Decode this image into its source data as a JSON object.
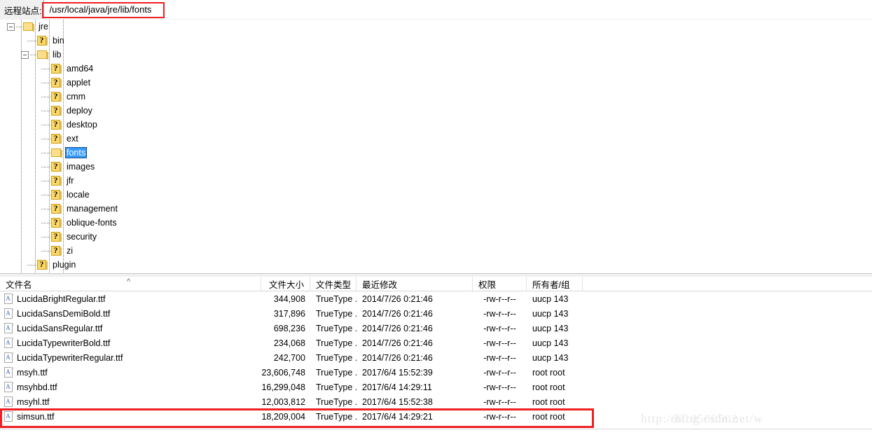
{
  "pathbar": {
    "label": "远程站点:",
    "value": "/usr/local/java/jre/lib/fonts",
    "placeholder": "/usr/local/java/jre/lib/fonts"
  },
  "highlight_color": "#ed2024",
  "selection_color": "#3399ff",
  "tree": {
    "nodes": [
      {
        "label": "jre",
        "depth": 4,
        "icon": "folder-icon",
        "expander": "expanded",
        "selected": false
      },
      {
        "label": "bin",
        "depth": 5,
        "icon": "unknown-folder-icon",
        "expander": "none",
        "selected": false
      },
      {
        "label": "lib",
        "depth": 5,
        "icon": "folder-icon",
        "expander": "expanded",
        "selected": false
      },
      {
        "label": "amd64",
        "depth": 6,
        "icon": "unknown-folder-icon",
        "expander": "none",
        "selected": false
      },
      {
        "label": "applet",
        "depth": 6,
        "icon": "unknown-folder-icon",
        "expander": "none",
        "selected": false
      },
      {
        "label": "cmm",
        "depth": 6,
        "icon": "unknown-folder-icon",
        "expander": "none",
        "selected": false
      },
      {
        "label": "deploy",
        "depth": 6,
        "icon": "unknown-folder-icon",
        "expander": "none",
        "selected": false
      },
      {
        "label": "desktop",
        "depth": 6,
        "icon": "unknown-folder-icon",
        "expander": "none",
        "selected": false
      },
      {
        "label": "ext",
        "depth": 6,
        "icon": "unknown-folder-icon",
        "expander": "none",
        "selected": false
      },
      {
        "label": "fonts",
        "depth": 6,
        "icon": "folder-icon",
        "expander": "none",
        "selected": true
      },
      {
        "label": "images",
        "depth": 6,
        "icon": "unknown-folder-icon",
        "expander": "none",
        "selected": false
      },
      {
        "label": "jfr",
        "depth": 6,
        "icon": "unknown-folder-icon",
        "expander": "none",
        "selected": false
      },
      {
        "label": "locale",
        "depth": 6,
        "icon": "unknown-folder-icon",
        "expander": "none",
        "selected": false
      },
      {
        "label": "management",
        "depth": 6,
        "icon": "unknown-folder-icon",
        "expander": "none",
        "selected": false
      },
      {
        "label": "oblique-fonts",
        "depth": 6,
        "icon": "unknown-folder-icon",
        "expander": "none",
        "selected": false
      },
      {
        "label": "security",
        "depth": 6,
        "icon": "unknown-folder-icon",
        "expander": "none",
        "selected": false
      },
      {
        "label": "zi",
        "depth": 6,
        "icon": "unknown-folder-icon",
        "expander": "none",
        "selected": false
      },
      {
        "label": "plugin",
        "depth": 5,
        "icon": "unknown-folder-icon",
        "expander": "none",
        "selected": false
      }
    ]
  },
  "filelist": {
    "columns": [
      {
        "label": "文件名",
        "align": "left"
      },
      {
        "label": "文件大小",
        "align": "right"
      },
      {
        "label": "文件类型",
        "align": "left"
      },
      {
        "label": "最近修改",
        "align": "left"
      },
      {
        "label": "权限",
        "align": "left"
      },
      {
        "label": "所有者/组",
        "align": "left"
      }
    ],
    "sort_indicator": "^",
    "rows": [
      {
        "name": "LucidaBrightRegular.ttf",
        "size": "344,908",
        "type": "TrueType ...",
        "modified": "2014/7/26 0:21:46",
        "permissions": "-rw-r--r--",
        "owner": "uucp 143",
        "highlighted": false
      },
      {
        "name": "LucidaSansDemiBold.ttf",
        "size": "317,896",
        "type": "TrueType ...",
        "modified": "2014/7/26 0:21:46",
        "permissions": "-rw-r--r--",
        "owner": "uucp 143",
        "highlighted": false
      },
      {
        "name": "LucidaSansRegular.ttf",
        "size": "698,236",
        "type": "TrueType ...",
        "modified": "2014/7/26 0:21:46",
        "permissions": "-rw-r--r--",
        "owner": "uucp 143",
        "highlighted": false
      },
      {
        "name": "LucidaTypewriterBold.ttf",
        "size": "234,068",
        "type": "TrueType ...",
        "modified": "2014/7/26 0:21:46",
        "permissions": "-rw-r--r--",
        "owner": "uucp 143",
        "highlighted": false
      },
      {
        "name": "LucidaTypewriterRegular.ttf",
        "size": "242,700",
        "type": "TrueType ...",
        "modified": "2014/7/26 0:21:46",
        "permissions": "-rw-r--r--",
        "owner": "uucp 143",
        "highlighted": false
      },
      {
        "name": "msyh.ttf",
        "size": "23,606,748",
        "type": "TrueType ...",
        "modified": "2017/6/4 15:52:39",
        "permissions": "-rw-r--r--",
        "owner": "root root",
        "highlighted": false
      },
      {
        "name": "msyhbd.ttf",
        "size": "16,299,048",
        "type": "TrueType ...",
        "modified": "2017/6/4 14:29:11",
        "permissions": "-rw-r--r--",
        "owner": "root root",
        "highlighted": false
      },
      {
        "name": "msyhl.ttf",
        "size": "12,003,812",
        "type": "TrueType ...",
        "modified": "2017/6/4 15:52:38",
        "permissions": "-rw-r--r--",
        "owner": "root root",
        "highlighted": false
      },
      {
        "name": "simsun.ttf",
        "size": "18,209,004",
        "type": "TrueType ...",
        "modified": "2017/6/4 14:29:21",
        "permissions": "-rw-r--r--",
        "owner": "root root",
        "highlighted": true
      }
    ]
  },
  "watermark": {
    "line1": "http://blog.csdn.net/w",
    "line2": "u010589502"
  }
}
